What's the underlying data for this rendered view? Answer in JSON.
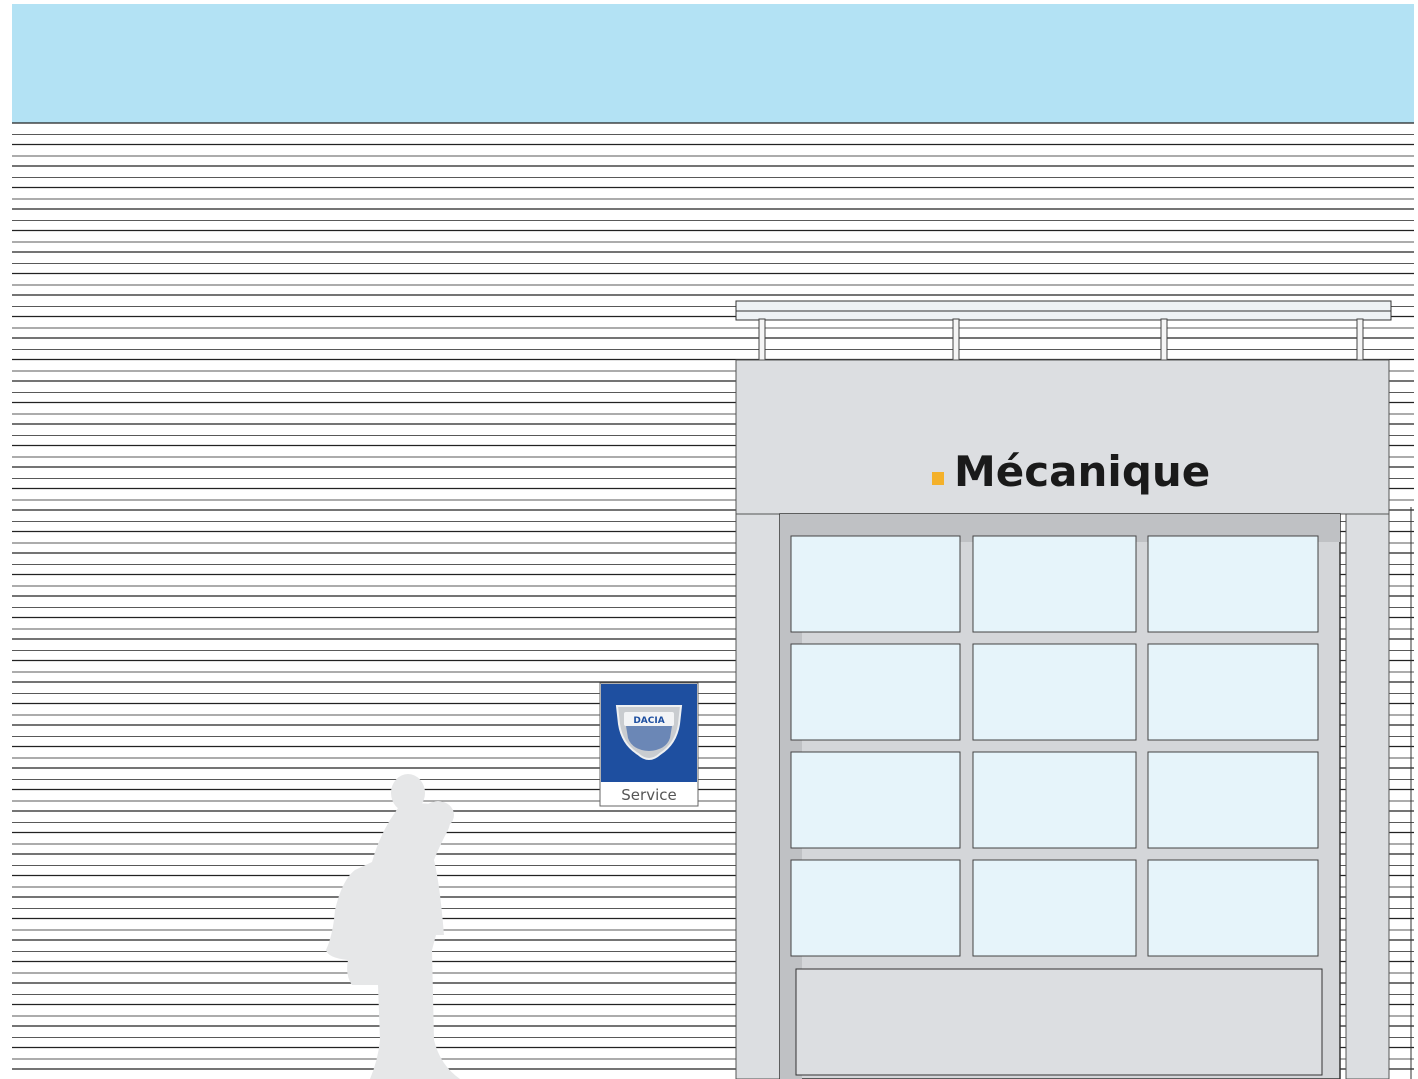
{
  "facade_sign": {
    "label": "Mécanique",
    "marker_color": "#f4b12a"
  },
  "brand_panel": {
    "logo_text": "DACIA",
    "caption": "Service",
    "panel_color": "#1e4fa0"
  },
  "colors": {
    "sky": "#b3e2f4",
    "cladding_line": "#222222",
    "fascia": "#dcdee1",
    "window_glass": "#e6f4fa",
    "silhouette": "#e6e7e8"
  }
}
